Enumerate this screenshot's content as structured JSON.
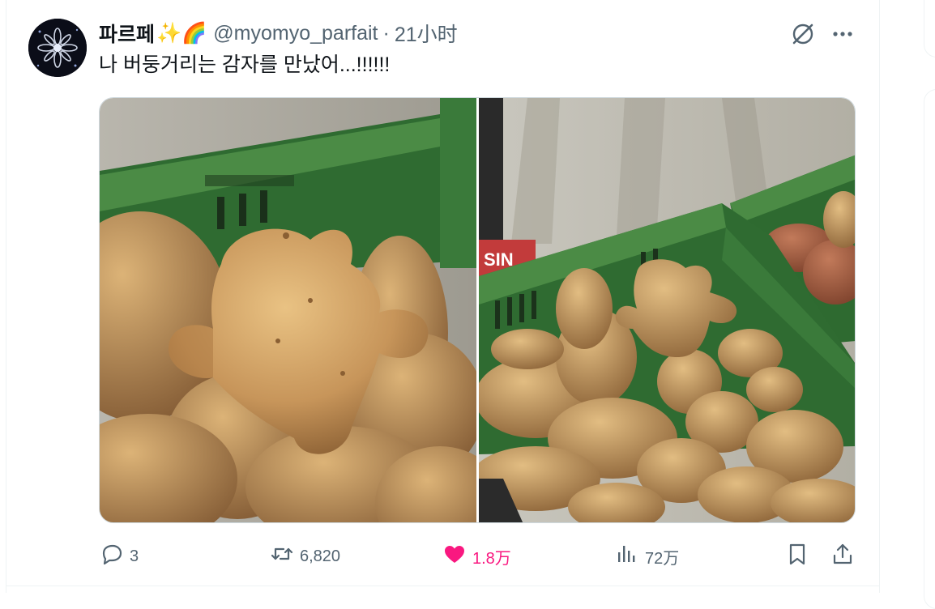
{
  "tweet": {
    "author_name": "파르페",
    "emoji": "✨🌈",
    "handle": "@myomyo_parfait",
    "separator": "·",
    "time": "21小时",
    "text": "나 버둥거리는 감자를 만났어...!!!!!!"
  },
  "actions": {
    "reply_count": "3",
    "retweet_count": "6,820",
    "like_count": "1.8万",
    "view_count": "72万"
  },
  "icons": {
    "grok": "grok-icon",
    "more": "more-icon",
    "reply": "reply-icon",
    "retweet": "retweet-icon",
    "like": "heart-icon",
    "views": "views-icon",
    "bookmark": "bookmark-icon",
    "share": "share-icon"
  },
  "colors": {
    "like_active": "#f91880",
    "secondary_text": "#536471",
    "crate_green": "#3f7f3a"
  },
  "photo_text": {
    "crate_label": "SIN"
  }
}
